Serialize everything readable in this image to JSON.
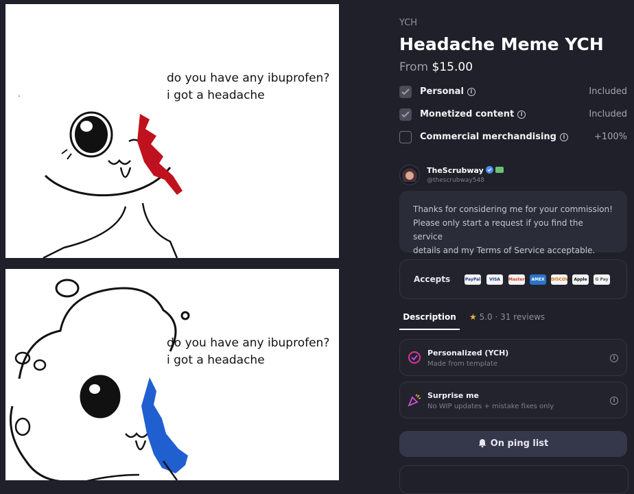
{
  "preview": {
    "top_caption": [
      "do you have any ibuprofen?",
      "i got a headache"
    ],
    "bottom_caption": [
      "do you have any ibuprofen?",
      "i got a headache"
    ]
  },
  "product": {
    "breadcrumb": "YCH",
    "title": "Headache Meme YCH",
    "price_prefix": "From",
    "price": "$15.00"
  },
  "options": [
    {
      "label": "Personal",
      "value": "Included",
      "checked": true
    },
    {
      "label": "Monetized content",
      "value": "Included",
      "checked": true
    },
    {
      "label": "Commercial merchandising",
      "value": "+100%",
      "checked": false
    }
  ],
  "seller": {
    "name": "TheScrubway",
    "handle": "@thescrubway548",
    "message": [
      "Thanks for considering me for your commission!",
      "Please only start a request if you find the service",
      "details and my Terms of Service acceptable."
    ]
  },
  "accepts": {
    "label": "Accepts",
    "methods": [
      "PayPal",
      "VISA",
      "Mastercard",
      "AMEX",
      "DISCOVER",
      "Apple Pay",
      "G Pay"
    ]
  },
  "tabs": {
    "description": "Description",
    "reviews": "5.0 · 31 reviews"
  },
  "features": [
    {
      "title": "Personalized (YCH)",
      "subtitle": "Made from template",
      "icon": "personalized-icon"
    },
    {
      "title": "Surprise me",
      "subtitle": "No WIP updates + mistake fixes only",
      "icon": "party-popper-icon"
    }
  ],
  "cta": {
    "label": "On ping list",
    "icon": "bell-icon"
  },
  "colors": {
    "background": "#1f2029",
    "card": "#2a2c37",
    "blood": "#c0121e",
    "blue": "#1f5fd0",
    "star": "#f2b33a"
  }
}
